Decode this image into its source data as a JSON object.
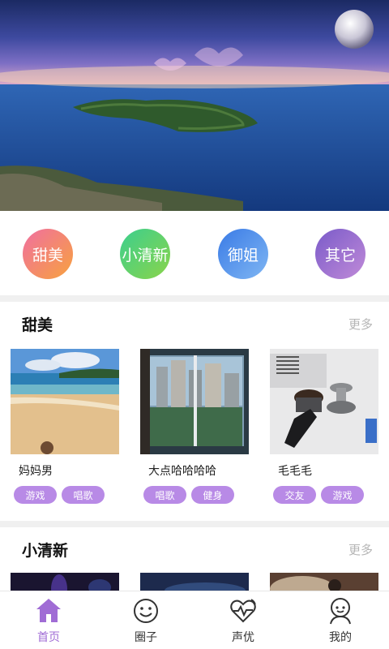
{
  "categories": [
    {
      "label": "甜美"
    },
    {
      "label": "小清新"
    },
    {
      "label": "御姐"
    },
    {
      "label": "其它"
    }
  ],
  "sections": [
    {
      "title": "甜美",
      "more": "更多",
      "cards": [
        {
          "name": "妈妈男",
          "tags": [
            "游戏",
            "唱歌"
          ]
        },
        {
          "name": "大点哈哈哈哈",
          "tags": [
            "唱歌",
            "健身"
          ]
        },
        {
          "name": "毛毛毛",
          "tags": [
            "交友",
            "游戏"
          ]
        }
      ]
    },
    {
      "title": "小清新",
      "more": "更多"
    }
  ],
  "tabbar": {
    "items": [
      {
        "label": "首页",
        "icon": "home-icon",
        "active": true
      },
      {
        "label": "圈子",
        "icon": "smiley-icon"
      },
      {
        "label": "声优",
        "icon": "heartbeat-icon"
      },
      {
        "label": "我的",
        "icon": "profile-icon"
      }
    ]
  },
  "colors": {
    "accent": "#a06cd5",
    "tag": "#b88ae6"
  }
}
